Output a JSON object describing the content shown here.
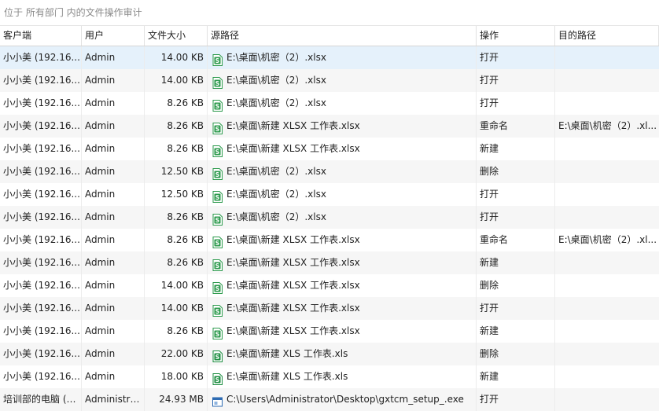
{
  "caption": "位于 所有部门 内的文件操作审计",
  "columns": [
    "客户端",
    "用户",
    "文件大小",
    "源路径",
    "操作",
    "目的路径"
  ],
  "colors": {
    "xlsx_icon": "#2e9b4e",
    "xls_icon": "#1f8f43",
    "exe_icon": "#2e6bb3",
    "selected_row": "#e5f1fb"
  },
  "rows": [
    {
      "client": "小小美 (192.16...",
      "user": "Admin",
      "size": "14.00 KB",
      "icon": "xlsx-file-icon",
      "source": "E:\\桌面\\机密（2）.xlsx",
      "op": "打开",
      "dest": ""
    },
    {
      "client": "小小美 (192.16...",
      "user": "Admin",
      "size": "14.00 KB",
      "icon": "xlsx-file-icon",
      "source": "E:\\桌面\\机密（2）.xlsx",
      "op": "打开",
      "dest": ""
    },
    {
      "client": "小小美 (192.16...",
      "user": "Admin",
      "size": "8.26 KB",
      "icon": "xlsx-file-icon",
      "source": "E:\\桌面\\机密（2）.xlsx",
      "op": "打开",
      "dest": ""
    },
    {
      "client": "小小美 (192.16...",
      "user": "Admin",
      "size": "8.26 KB",
      "icon": "xlsx-file-icon",
      "source": "E:\\桌面\\新建 XLSX 工作表.xlsx",
      "op": "重命名",
      "dest": "E:\\桌面\\机密（2）.xl..."
    },
    {
      "client": "小小美 (192.16...",
      "user": "Admin",
      "size": "8.26 KB",
      "icon": "xlsx-file-icon",
      "source": "E:\\桌面\\新建 XLSX 工作表.xlsx",
      "op": "新建",
      "dest": ""
    },
    {
      "client": "小小美 (192.16...",
      "user": "Admin",
      "size": "12.50 KB",
      "icon": "xlsx-file-icon",
      "source": "E:\\桌面\\机密（2）.xlsx",
      "op": "删除",
      "dest": ""
    },
    {
      "client": "小小美 (192.16...",
      "user": "Admin",
      "size": "12.50 KB",
      "icon": "xlsx-file-icon",
      "source": "E:\\桌面\\机密（2）.xlsx",
      "op": "打开",
      "dest": ""
    },
    {
      "client": "小小美 (192.16...",
      "user": "Admin",
      "size": "8.26 KB",
      "icon": "xlsx-file-icon",
      "source": "E:\\桌面\\机密（2）.xlsx",
      "op": "打开",
      "dest": ""
    },
    {
      "client": "小小美 (192.16...",
      "user": "Admin",
      "size": "8.26 KB",
      "icon": "xlsx-file-icon",
      "source": "E:\\桌面\\新建 XLSX 工作表.xlsx",
      "op": "重命名",
      "dest": "E:\\桌面\\机密（2）.xl..."
    },
    {
      "client": "小小美 (192.16...",
      "user": "Admin",
      "size": "8.26 KB",
      "icon": "xlsx-file-icon",
      "source": "E:\\桌面\\新建 XLSX 工作表.xlsx",
      "op": "新建",
      "dest": ""
    },
    {
      "client": "小小美 (192.16...",
      "user": "Admin",
      "size": "14.00 KB",
      "icon": "xlsx-file-icon",
      "source": "E:\\桌面\\新建 XLSX 工作表.xlsx",
      "op": "删除",
      "dest": ""
    },
    {
      "client": "小小美 (192.16...",
      "user": "Admin",
      "size": "14.00 KB",
      "icon": "xlsx-file-icon",
      "source": "E:\\桌面\\新建 XLSX 工作表.xlsx",
      "op": "打开",
      "dest": ""
    },
    {
      "client": "小小美 (192.16...",
      "user": "Admin",
      "size": "8.26 KB",
      "icon": "xlsx-file-icon",
      "source": "E:\\桌面\\新建 XLSX 工作表.xlsx",
      "op": "新建",
      "dest": ""
    },
    {
      "client": "小小美 (192.16...",
      "user": "Admin",
      "size": "22.00 KB",
      "icon": "xls-file-icon",
      "source": "E:\\桌面\\新建 XLS 工作表.xls",
      "op": "删除",
      "dest": ""
    },
    {
      "client": "小小美 (192.16...",
      "user": "Admin",
      "size": "18.00 KB",
      "icon": "xls-file-icon",
      "source": "E:\\桌面\\新建 XLS 工作表.xls",
      "op": "新建",
      "dest": ""
    },
    {
      "client": "培训部的电脑 (1...",
      "user": "Administra...",
      "size": "24.93 MB",
      "icon": "exe-file-icon",
      "source": "C:\\Users\\Administrator\\Desktop\\gxtcm_setup_.exe",
      "op": "打开",
      "dest": ""
    }
  ]
}
